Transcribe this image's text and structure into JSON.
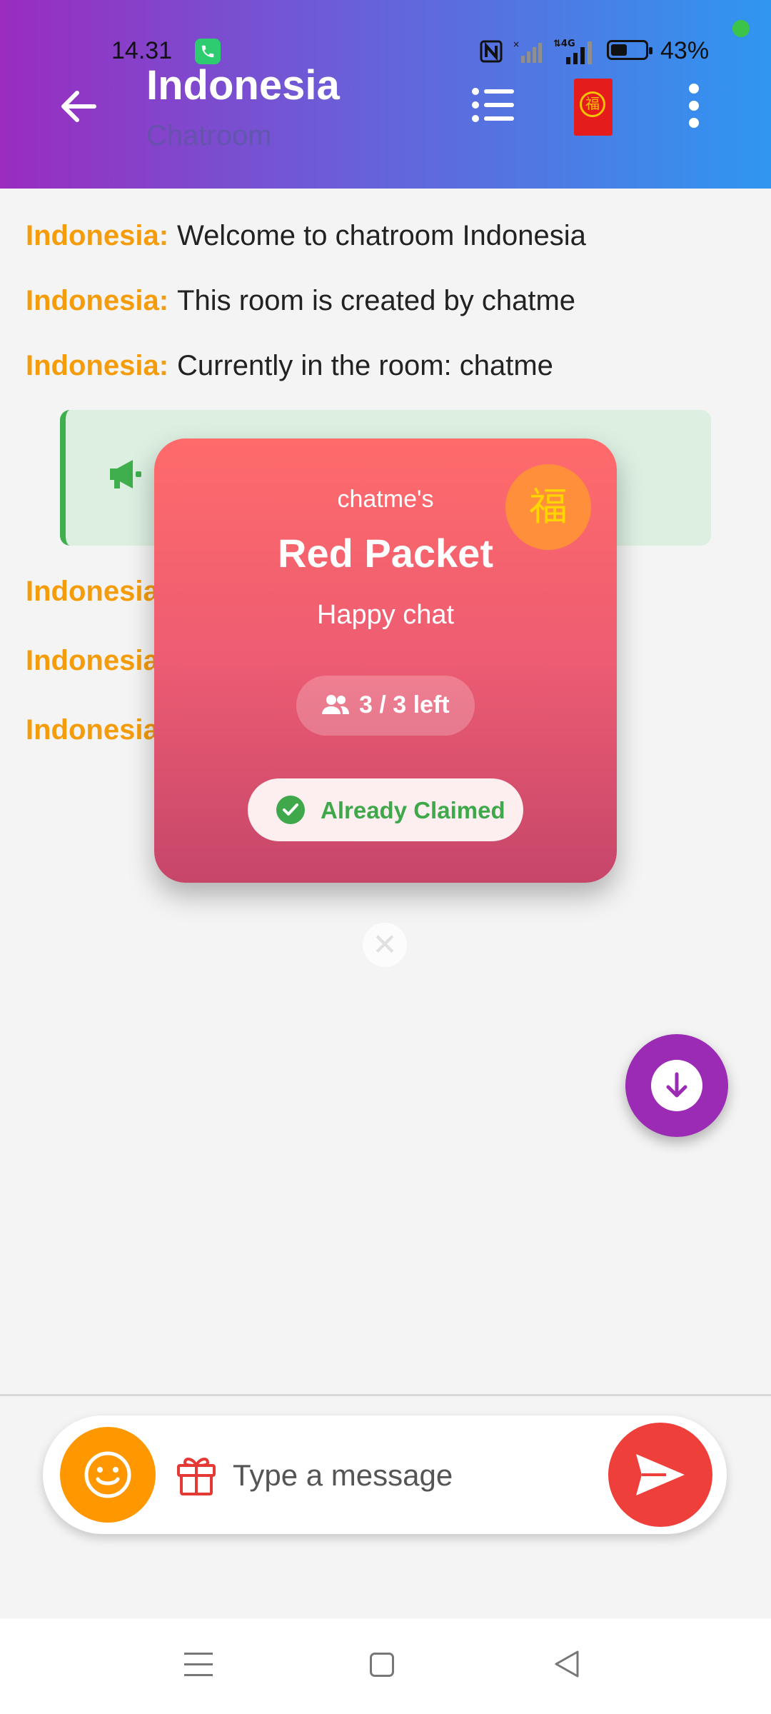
{
  "status_bar": {
    "time": "14.31",
    "battery": "43%",
    "signal_label": "4G"
  },
  "header": {
    "title": "Indonesia",
    "subtitle": "Chatroom",
    "icons": [
      "back-arrow-icon",
      "list-icon",
      "red-packet-icon",
      "more-vertical-icon"
    ]
  },
  "messages": [
    {
      "sender": "Indonesia:",
      "text": "Welcome to chatroom Indonesia"
    },
    {
      "sender": "Indonesia:",
      "text": "This room is created by chatme"
    },
    {
      "sender": "Indonesia:",
      "text": "Currently in the room: chatme"
    }
  ],
  "partial_messages": [
    {
      "sender": "Indonesia"
    },
    {
      "sender": "Indonesia"
    },
    {
      "sender": "Indonesia"
    }
  ],
  "red_packet": {
    "sender": "chatme's",
    "title": "Red Packet",
    "message": "Happy chat",
    "remaining": "3 / 3 left",
    "status": "Already Claimed",
    "badge_char": "福"
  },
  "composer": {
    "placeholder": "Type a message"
  },
  "colors": {
    "sender": "#f59c0b",
    "fab": "#9b2bb5",
    "send": "#ef3f3a",
    "emoji": "#ff9800",
    "claimed": "#3ea84a"
  }
}
